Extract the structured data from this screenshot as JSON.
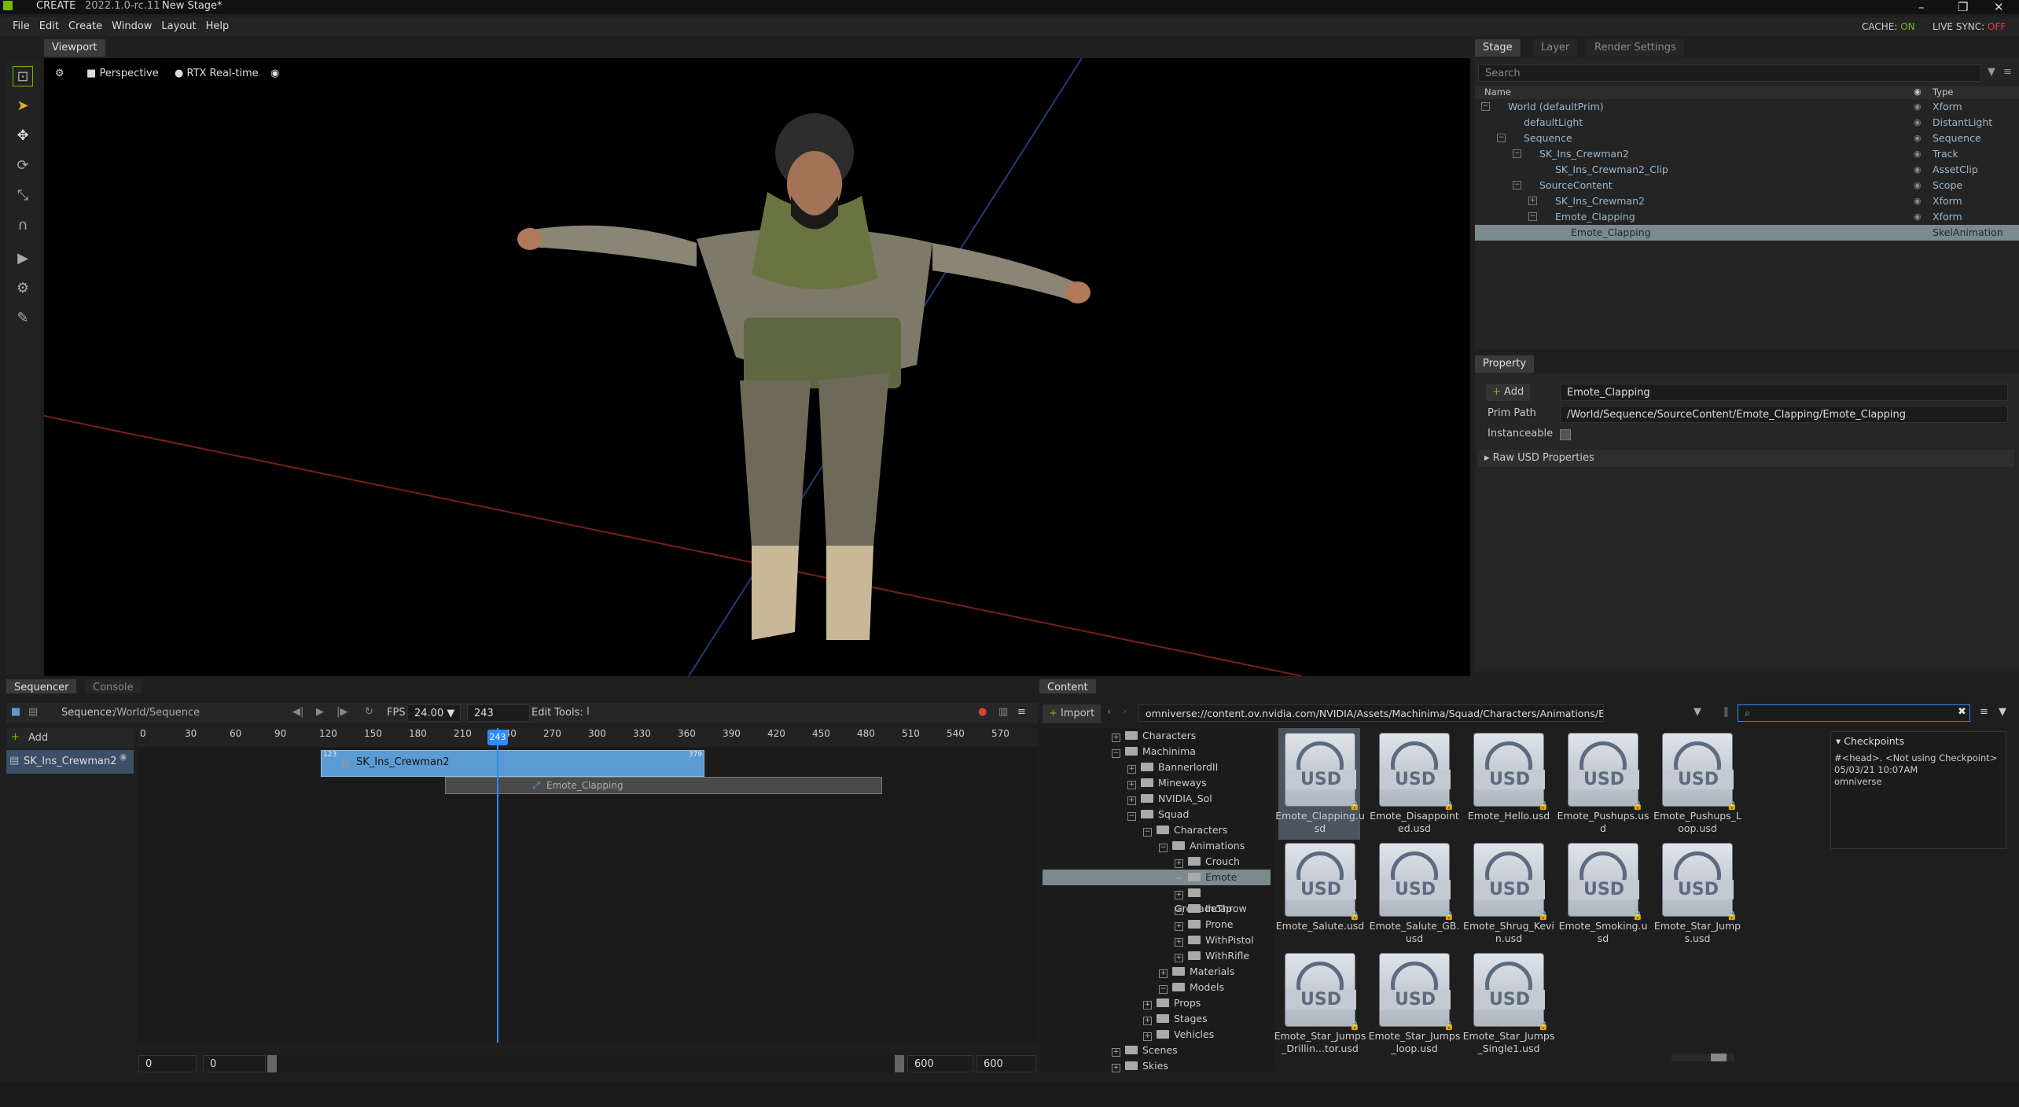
{
  "titlebar": {
    "app": "CREATE",
    "version": "2022.1.0-rc.11",
    "stage": "New Stage*"
  },
  "menu": [
    "File",
    "Edit",
    "Create",
    "Window",
    "Layout",
    "Help"
  ],
  "status": {
    "cache_label": "CACHE:",
    "cache_value": "ON",
    "live_label": "LIVE SYNC:",
    "live_value": "OFF"
  },
  "viewport": {
    "tab": "Viewport",
    "camera": "Perspective",
    "renderer": "RTX Real-time"
  },
  "stage": {
    "tabs": [
      "Stage",
      "Layer",
      "Render Settings"
    ],
    "search_placeholder": "Search",
    "col_name": "Name",
    "col_type": "Type",
    "rows": [
      {
        "name": "World (defaultPrim)",
        "type": "Xform"
      },
      {
        "name": "defaultLight",
        "type": "DistantLight"
      },
      {
        "name": "Sequence",
        "type": "Sequence"
      },
      {
        "name": "SK_Ins_Crewman2",
        "type": "Track"
      },
      {
        "name": "SK_Ins_Crewman2_Clip",
        "type": "AssetClip"
      },
      {
        "name": "SourceContent",
        "type": "Scope"
      },
      {
        "name": "SK_Ins_Crewman2",
        "type": "Xform"
      },
      {
        "name": "Emote_Clapping",
        "type": "Xform"
      },
      {
        "name": "Emote_Clapping",
        "type": "SkelAnimation"
      }
    ]
  },
  "property": {
    "tab": "Property",
    "add": "Add",
    "name_value": "Emote_Clapping",
    "prim_path_label": "Prim Path",
    "prim_path": "/World/Sequence/SourceContent/Emote_Clapping/Emote_Clapping",
    "instanceable_label": "Instanceable",
    "raw": "Raw USD Properties"
  },
  "sequencer": {
    "tabs": [
      "Sequencer",
      "Console"
    ],
    "sequence_label": "Sequence:",
    "sequence_path": "/World/Sequence",
    "fps_label": "FPS",
    "fps": "24.00",
    "frame": "243",
    "edit_tools": "Edit Tools:",
    "add": "Add",
    "track": "SK_Ins_Crewman2",
    "ticks": [
      "0",
      "30",
      "60",
      "90",
      "120",
      "150",
      "180",
      "210",
      "240",
      "270",
      "300",
      "330",
      "360",
      "390",
      "420",
      "450",
      "480",
      "510",
      "540",
      "570"
    ],
    "playhead": "243",
    "clip_name": "SK_Ins_Crewman2",
    "clip_start": "123",
    "clip_end": "379",
    "anim_clip": "Emote_Clapping",
    "range_start": "0",
    "range_start2": "0",
    "range_end": "600",
    "range_end2": "600"
  },
  "content": {
    "tab": "Content",
    "import": "Import",
    "path": "omniverse://content.ov.nvidia.com/NVIDIA/Assets/Machinima/Squad/Characters/Animations/Emote/",
    "tree": [
      "Characters",
      "Machinima",
      "BannerlordII",
      "Mineways",
      "NVIDIA_Sol",
      "Squad",
      "Characters",
      "Animations",
      "Crouch",
      "Emote",
      "GrenadeThrow",
      "Incap",
      "Prone",
      "WithPistol",
      "WithRifle",
      "Materials",
      "Models",
      "Props",
      "Stages",
      "Vehicles",
      "Scenes",
      "Skies"
    ],
    "files": [
      "Emote_Clapping.usd",
      "Emote_Disappointed.usd",
      "Emote_Hello.usd",
      "Emote_Pushups.usd",
      "Emote_Pushups_Loop.usd",
      "Emote_Salute.usd",
      "Emote_Salute_GB.usd",
      "Emote_Shrug_Kevin.usd",
      "Emote_Smoking.usd",
      "Emote_Star_Jumps.usd",
      "Emote_Star_Jumps_Drillin...tor.usd",
      "Emote_Star_Jumps_loop.usd",
      "Emote_Star_Jumps_Single1.usd"
    ],
    "checkpoints_title": "Checkpoints",
    "checkpoint_line1": "#<head>.  <Not using Checkpoint>",
    "checkpoint_line2": "05/03/21 10:07AM",
    "checkpoint_line3": "omniverse"
  },
  "colors": {
    "accent": "#76b900",
    "selection": "#7a8a8e",
    "clip": "#5a9bd4",
    "playhead": "#2d8cff",
    "off": "#e04040"
  }
}
